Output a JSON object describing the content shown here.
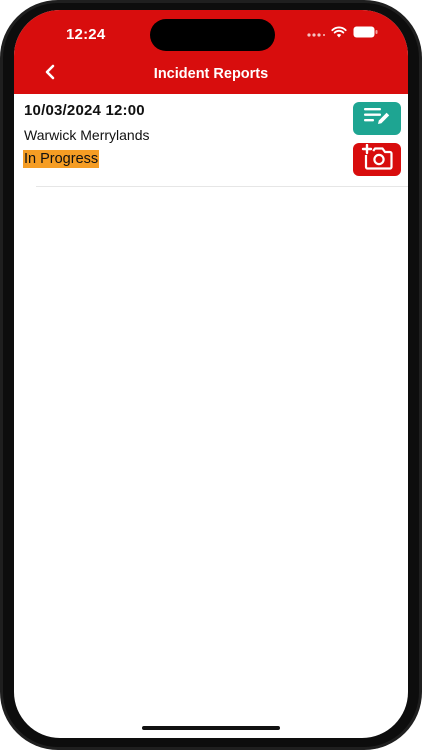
{
  "status_bar": {
    "time": "12:24",
    "icons": [
      "signal-dots-icon",
      "wifi-icon",
      "battery-icon"
    ]
  },
  "nav": {
    "title": "Incident Reports",
    "back_icon": "chevron-left-icon"
  },
  "reports": [
    {
      "datetime": "10/03/2024 12:00",
      "location": "Warwick Merrylands",
      "status": "In Progress",
      "actions": [
        "edit-note-icon",
        "add-photo-icon"
      ]
    }
  ],
  "colors": {
    "brand_red": "#d80d0d",
    "edit_teal": "#1ea592",
    "status_orange": "#f59d24"
  }
}
